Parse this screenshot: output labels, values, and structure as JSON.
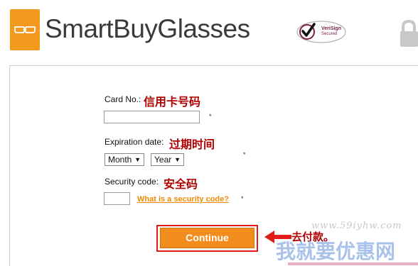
{
  "header": {
    "logo_text": "SmartBuyGlasses",
    "seal_line1": "VeriSign",
    "seal_line2": "Secured"
  },
  "form": {
    "card_label": "Card No.:",
    "card_label_cn": "信用卡号码",
    "card_value": "",
    "required_mark": "*",
    "expiration_label": "Expiration date:",
    "expiration_label_cn": "过期时间",
    "month_select": "Month",
    "year_select": "Year",
    "security_label": "Security code:",
    "security_label_cn": "安全码",
    "security_value": "",
    "security_link": "What is a security code?",
    "continue_button": "Continue",
    "note_cn": "去付款。"
  },
  "watermark": {
    "url": "www.59iyhw.com",
    "text_cn": "我就要优惠网"
  },
  "colors": {
    "brand_orange": "#f39a1e",
    "button_orange": "#f28c1c",
    "annotation_red": "#b00000",
    "highlight_red": "#e21b1b",
    "watermark_blue": "#9bb8e6"
  },
  "icons": [
    "glasses-logo-icon",
    "verisign-check-icon",
    "lock-icon",
    "dropdown-arrow-icon",
    "red-arrow-icon"
  ]
}
